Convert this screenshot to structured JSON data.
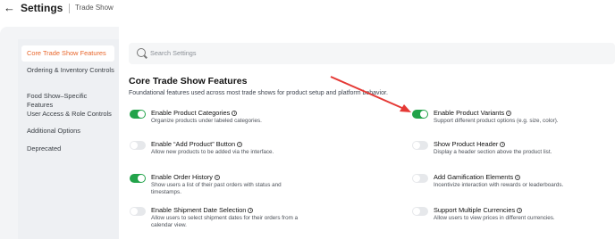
{
  "header": {
    "title": "Settings",
    "subtitle": "Trade Show",
    "back_icon": "arrow-left-icon"
  },
  "sidebar": {
    "items": [
      {
        "label": "Core Trade Show Features",
        "active": true
      },
      {
        "label": "Ordering & Inventory Controls",
        "active": false
      },
      {
        "label": "Food Show–Specific Features",
        "active": false
      },
      {
        "label": "User Access & Role Controls",
        "active": false
      },
      {
        "label": "Additional Options",
        "active": false
      },
      {
        "label": "Deprecated",
        "active": false
      }
    ]
  },
  "search": {
    "placeholder": "Search Settings",
    "icon": "search-icon"
  },
  "section": {
    "title": "Core Trade Show Features",
    "description": "Foundational features used across most trade shows for product setup and platform behavior."
  },
  "features_left": [
    {
      "title": "Enable Product Categories",
      "desc": "Organize products under labeled categories.",
      "enabled": true
    },
    {
      "title": "Enable “Add Product” Button",
      "desc": "Allow new products to be added via the interface.",
      "enabled": false
    },
    {
      "title": "Enable Order History",
      "desc": "Show users a list of their past orders with status and timestamps.",
      "enabled": true
    },
    {
      "title": "Enable Shipment Date Selection",
      "desc": "Allow users to select shipment dates for their orders from a calendar view.",
      "enabled": false
    }
  ],
  "features_right": [
    {
      "title": "Enable Product Variants",
      "desc": "Support different product options (e.g. size, color).",
      "enabled": true
    },
    {
      "title": "Show Product Header",
      "desc": "Display a header section above the product list.",
      "enabled": false
    },
    {
      "title": "Add Gamification Elements",
      "desc": "Incentivize interaction with rewards or leaderboards.",
      "enabled": false
    },
    {
      "title": "Support Multiple Currencies",
      "desc": "Allow users to view prices in different currencies.",
      "enabled": false
    }
  ],
  "colors": {
    "accent": "#e8662b",
    "toggle_on": "#22a34a",
    "annotation_arrow": "#e53935"
  }
}
